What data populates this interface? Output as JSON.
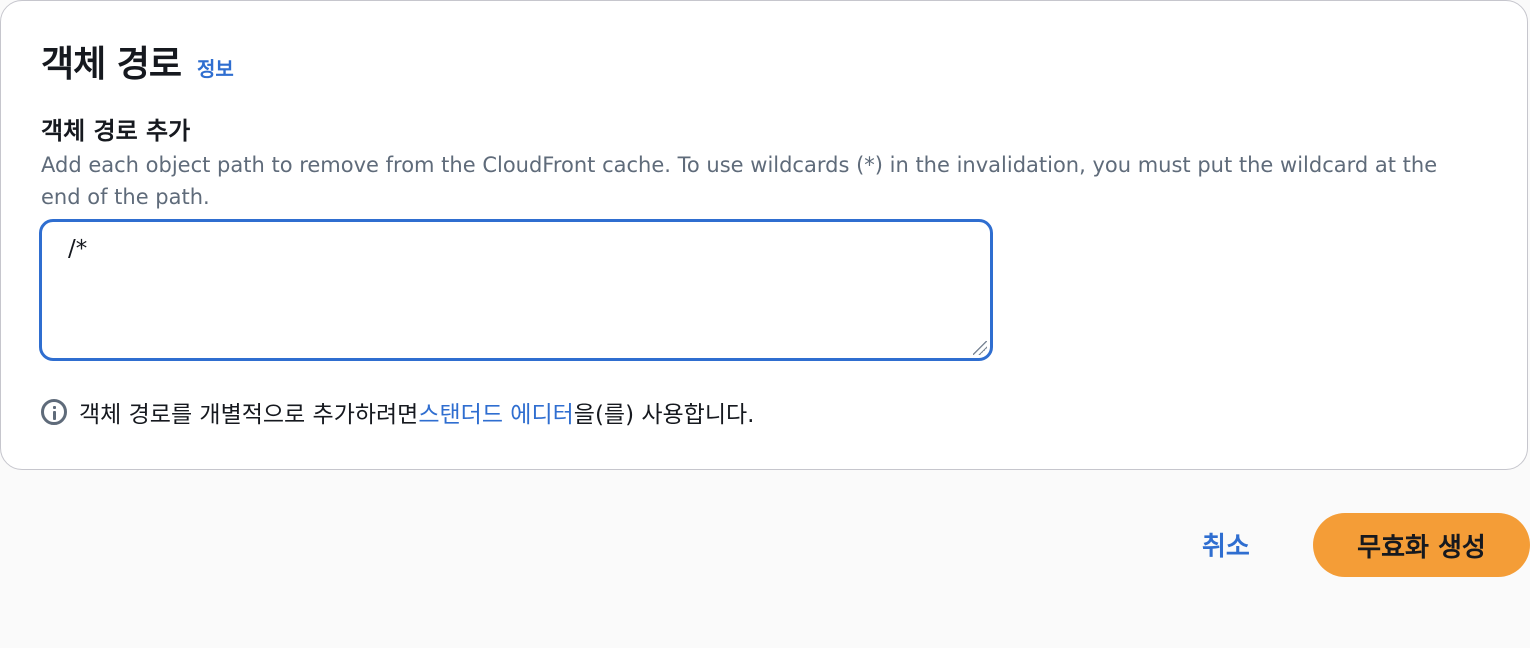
{
  "section": {
    "title": "객체 경로",
    "info_link": "정보"
  },
  "field": {
    "label": "객체 경로 추가",
    "description": "Add each object path to remove from the CloudFront cache. To use wildcards (*) in the invalidation, you must put the wildcard at the end of the path.",
    "value": "/*"
  },
  "hint": {
    "prefix": "객체 경로를 개별적으로 추가하려면 ",
    "link": "스탠더드 에디터",
    "suffix": "을(를) 사용합니다."
  },
  "actions": {
    "cancel_label": "취소",
    "create_label": "무효화 생성"
  },
  "colors": {
    "accent": "#2f6ed0",
    "primary_button": "#f49d37"
  }
}
